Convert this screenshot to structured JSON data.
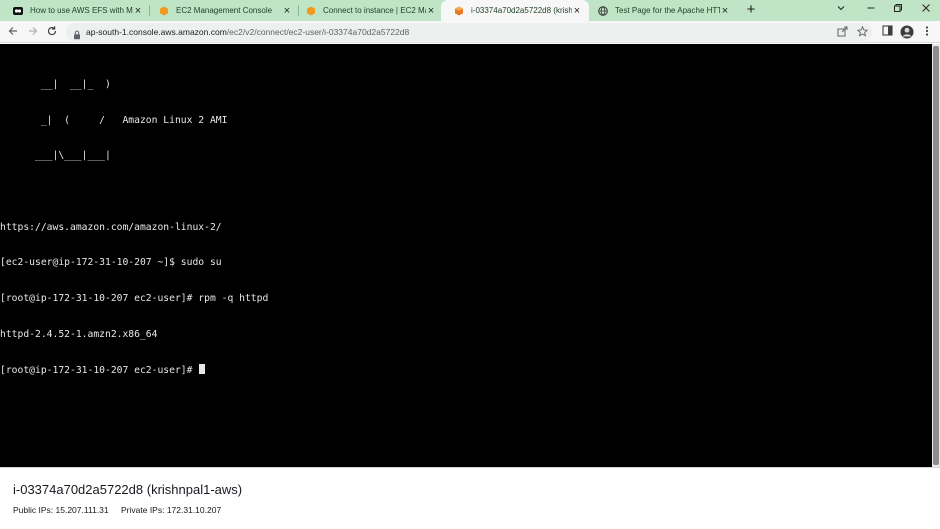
{
  "browser": {
    "tabs": [
      {
        "title": "How to use AWS EFS with Multip",
        "favicon": "logo-icon",
        "active": false
      },
      {
        "title": "EC2 Management Console",
        "favicon": "aws-icon",
        "active": false
      },
      {
        "title": "Connect to instance | EC2 Manag",
        "favicon": "aws-icon",
        "active": false
      },
      {
        "title": "i-03374a70d2a5722d8 (krishnpal",
        "favicon": "ec2-icon",
        "active": true
      },
      {
        "title": "Test Page for the Apache HTTP S",
        "favicon": "globe-icon",
        "active": false
      }
    ],
    "address_bar": {
      "url_host": "ap-south-1.console.aws.amazon.com",
      "url_path": "/ec2/v2/connect/ec2-user/i-03374a70d2a5722d8"
    },
    "colors": {
      "tab_strip": "#bfe5c6",
      "active_tab": "#f7f7f7"
    }
  },
  "terminal": {
    "lines": [
      "       __|  __|_  )",
      "       _|  (     /   Amazon Linux 2 AMI",
      "      ___|\\___|___|",
      "",
      "https://aws.amazon.com/amazon-linux-2/",
      "[ec2-user@ip-172-31-10-207 ~]$ sudo su",
      "[root@ip-172-31-10-207 ec2-user]# rpm -q httpd",
      "httpd-2.4.52-1.amzn2.x86_64",
      "[root@ip-172-31-10-207 ec2-user]# "
    ]
  },
  "instance": {
    "title": "i-03374a70d2a5722d8 (krishnpal1-aws)",
    "public_ips": "Public IPs: 15.207.111.31",
    "private_ips": "Private IPs: 172.31.10.207"
  }
}
